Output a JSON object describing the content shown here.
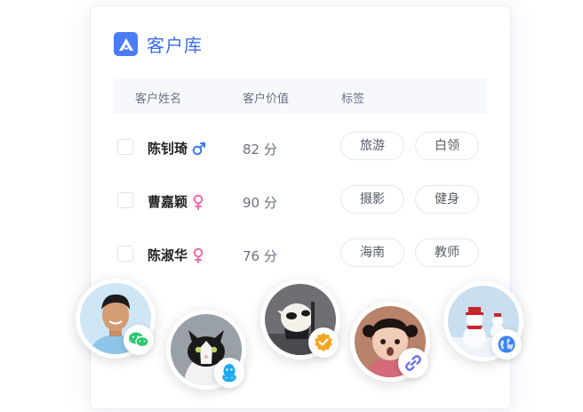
{
  "app": {
    "title": "客户库"
  },
  "table": {
    "headers": {
      "name": "客户姓名",
      "value": "客户价值",
      "tags": "标签"
    },
    "rows": [
      {
        "name": "陈钊琦",
        "gender": "male",
        "score": "82 分",
        "tags": [
          "旅游",
          "白领"
        ]
      },
      {
        "name": "曹嘉颖",
        "gender": "female",
        "score": "90 分",
        "tags": [
          "摄影",
          "健身"
        ]
      },
      {
        "name": "陈淑华",
        "gender": "female",
        "score": "76 分",
        "tags": [
          "海南",
          "教师"
        ]
      }
    ]
  },
  "avatars": [
    {
      "subject": "man",
      "badge": "wechat-icon"
    },
    {
      "subject": "cat",
      "badge": "qq-icon"
    },
    {
      "subject": "alpaca",
      "badge": "verified-icon"
    },
    {
      "subject": "girl",
      "badge": "link-icon"
    },
    {
      "subject": "snowman",
      "badge": "globe-icon"
    }
  ],
  "colors": {
    "brand": "#3d6df0",
    "male": "#3b78f0",
    "female": "#f26aa6",
    "wechat": "#2dc76d",
    "qq": "#1ea9f0",
    "verified": "#f5a623",
    "link": "#6d6ff5",
    "globe": "#3b82f6"
  }
}
